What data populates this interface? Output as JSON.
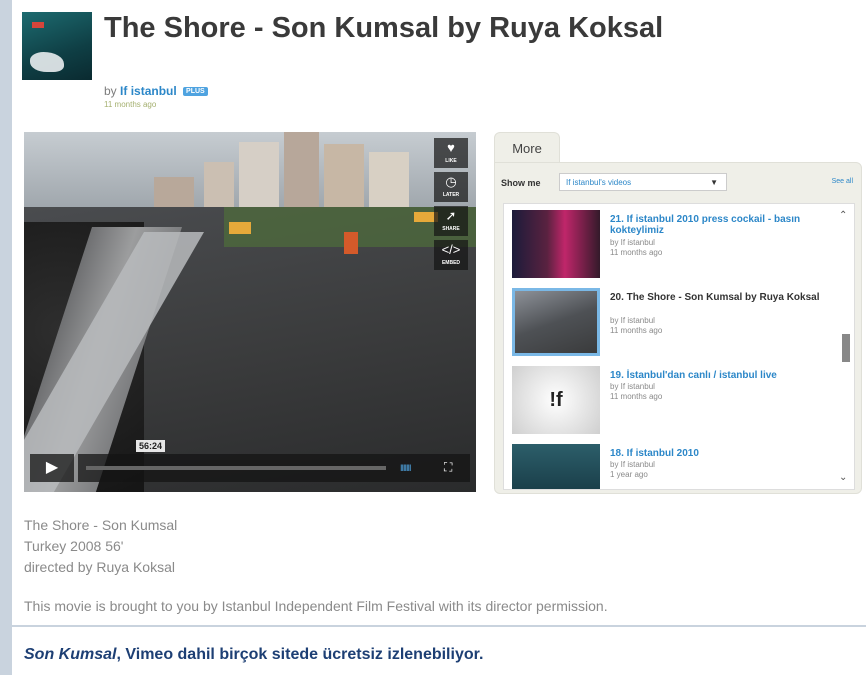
{
  "header": {
    "title": "The Shore - Son Kumsal by Ruya Koksal",
    "by_prefix": "by",
    "author": "If istanbul",
    "plus_badge": "PLUS",
    "ago": "11 months ago"
  },
  "player": {
    "actions": [
      {
        "icon": "heart-icon",
        "glyph": "♥",
        "label": "LIKE"
      },
      {
        "icon": "clock-icon",
        "glyph": "◷",
        "label": "LATER"
      },
      {
        "icon": "share-icon",
        "glyph": "➚",
        "label": "SHARE"
      },
      {
        "icon": "embed-icon",
        "glyph": "</>",
        "label": "EMBED"
      }
    ],
    "timecode": "56:24",
    "play_glyph": "▶",
    "volume_glyph": "IIIIIII",
    "fullscreen_glyph": "⛶"
  },
  "more": {
    "tab_label": "More",
    "show_me_label": "Show me",
    "select_value": "If istanbul's videos",
    "see_all": "See all",
    "items": [
      {
        "title": "21. If istanbul 2010 press cockail - basın kokteylimiz",
        "by": "by If istanbul",
        "ago": "11 months ago"
      },
      {
        "title": "20. The Shore - Son Kumsal by Ruya Koksal",
        "by": "by If istanbul",
        "ago": "11 months ago"
      },
      {
        "title": "19. İstanbul'dan canlı / istanbul live",
        "by": "by If istanbul",
        "ago": "11 months ago"
      },
      {
        "title": "18. If istanbul 2010",
        "by": "by If istanbul",
        "ago": "1 year ago"
      }
    ],
    "logo_text": "!f"
  },
  "description": {
    "line1": "The Shore - Son Kumsal",
    "line2": "Turkey 2008 56'",
    "line3": "directed by Ruya Koksal",
    "note": "This movie is brought to you by Istanbul Independent Film Festival with its director permission."
  },
  "caption": {
    "italic": "Son Kumsal",
    "rest": ", Vimeo dahil birçok sitede ücretsiz izlenebiliyor."
  },
  "colors": {
    "link": "#2c87c8",
    "caption": "#1d3f74",
    "sidebar_bar": "#c9d3de"
  }
}
